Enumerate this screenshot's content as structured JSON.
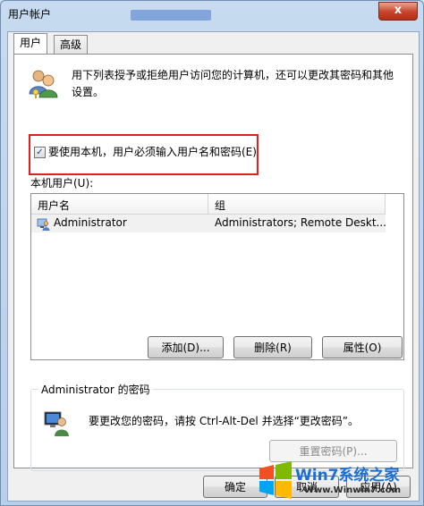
{
  "window": {
    "title": "用户帐户",
    "close_glyph": "x"
  },
  "tabs": [
    {
      "label": "用户",
      "active": true
    },
    {
      "label": "高级",
      "active": false
    }
  ],
  "description": "用下列表授予或拒绝用户访问您的计算机，还可以更改其密码和其他设置。",
  "require_login": {
    "label": "要使用本机，用户必须输入用户名和密码(E)",
    "checked": true,
    "check_glyph": "✓"
  },
  "local_users": {
    "label": "本机用户(U):",
    "columns": [
      "用户名",
      "组"
    ],
    "rows": [
      {
        "username": "Administrator",
        "groups": "Administrators; Remote Deskt..."
      }
    ]
  },
  "actions": {
    "add": "添加(D)...",
    "remove": "删除(R)",
    "properties": "属性(O)"
  },
  "password_group": {
    "title": "Administrator 的密码",
    "text": "要更改您的密码，请按 Ctrl-Alt-Del 并选择“更改密码”。",
    "reset_button": "重置密码(P)..."
  },
  "dialog_buttons": {
    "ok": "确定",
    "cancel": "取消",
    "apply": "应用(A)"
  },
  "watermark": {
    "text": "Win7系统之家",
    "url": "Www.Winwin7.com"
  },
  "colors": {
    "highlight": "#e02020",
    "brand": "#1a6fd6"
  }
}
